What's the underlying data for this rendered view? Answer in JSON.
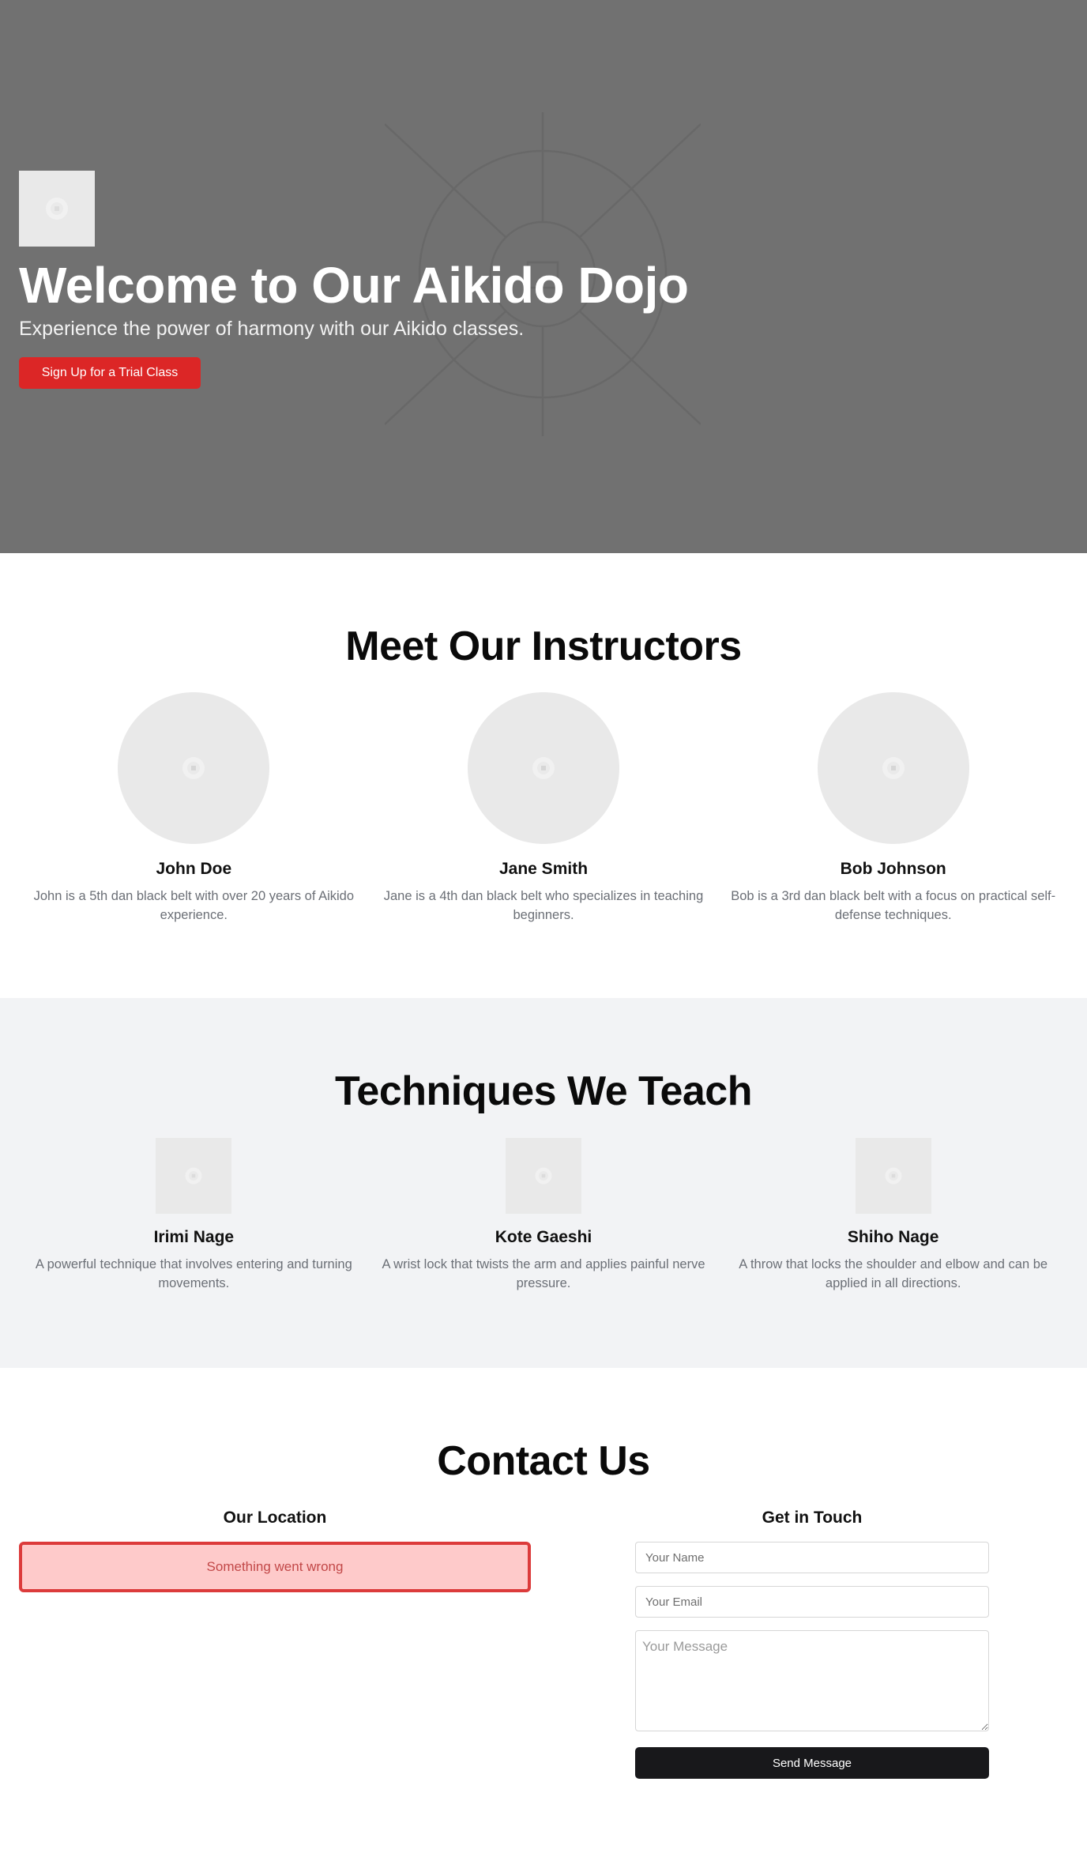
{
  "hero": {
    "title": "Welcome to Our Aikido Dojo",
    "subtitle": "Experience the power of harmony with our Aikido classes.",
    "cta_label": "Sign Up for a Trial Class",
    "logo_icon": "image-placeholder-icon",
    "background_icon": "dojo-emblem-icon",
    "accent_color": "#dc2626"
  },
  "instructors": {
    "title": "Meet Our Instructors",
    "items": [
      {
        "name": "John Doe",
        "description": "John is a 5th dan black belt with over 20 years of Aikido experience."
      },
      {
        "name": "Jane Smith",
        "description": "Jane is a 4th dan black belt who specializes in teaching beginners."
      },
      {
        "name": "Bob Johnson",
        "description": "Bob is a 3rd dan black belt with a focus on practical self-defense techniques."
      }
    ]
  },
  "techniques": {
    "title": "Techniques We Teach",
    "items": [
      {
        "name": "Irimi Nage",
        "description": "A powerful technique that involves entering and turning movements."
      },
      {
        "name": "Kote Gaeshi",
        "description": "A wrist lock that twists the arm and applies painful nerve pressure."
      },
      {
        "name": "Shiho Nage",
        "description": "A throw that locks the shoulder and elbow and can be applied in all directions."
      }
    ]
  },
  "contact": {
    "title": "Contact Us",
    "location_title": "Our Location",
    "map_error": "Something went wrong",
    "form_title": "Get in Touch",
    "name_placeholder": "Your Name",
    "email_placeholder": "Your Email",
    "message_placeholder": "Your Message",
    "submit_label": "Send Message",
    "button_color": "#18181b"
  }
}
